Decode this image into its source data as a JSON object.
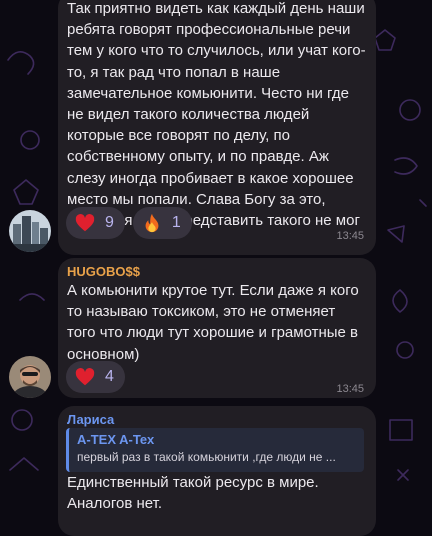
{
  "colors": {
    "background": "#0c0a12",
    "bubble": "#211e24",
    "reaction_pill": "#37333e",
    "reaction_count": "#b9b4ee",
    "sender_hugobo": "#e9a24a",
    "sender_larisa": "#6c96f0",
    "quote_bar": "#5f8be8"
  },
  "messages": [
    {
      "text": "Так приятно видеть как каждый день наши ребята говорят профессиональные речи тем у кого что то случилось, или учат кого-то, я так рад что попал в наше замечательное комьюнити. Често ни где не видел такого количества людей которые все говорят по делу, по собственному опыту, и по правде. Аж слезу иногда пробивает в какое хорошее место мы попали. Слава Богу за это, раньше я даже представить такого не мог",
      "time": "13:45",
      "avatar": "city-skyline-avatar",
      "reactions": [
        {
          "emoji": "heart-icon",
          "count": "9"
        },
        {
          "emoji": "fire-icon",
          "count": "1"
        }
      ]
    },
    {
      "sender": "HUGOBO$$",
      "text": "А комьюнити крутое тут. Если даже я кого то называю токсиком, это не отменяет того что люди тут хорошие и грамотные в основном)",
      "time": "13:45",
      "avatar": "man-portrait-avatar",
      "reactions": [
        {
          "emoji": "heart-icon",
          "count": "4"
        }
      ]
    },
    {
      "sender": "Лариса",
      "quote": {
        "author": "A-TEX A-Tex",
        "text": "первый раз в такой комьюнити ,где люди не ..."
      },
      "text": "Единственный такой ресурс в мире. Аналогов нет."
    }
  ]
}
